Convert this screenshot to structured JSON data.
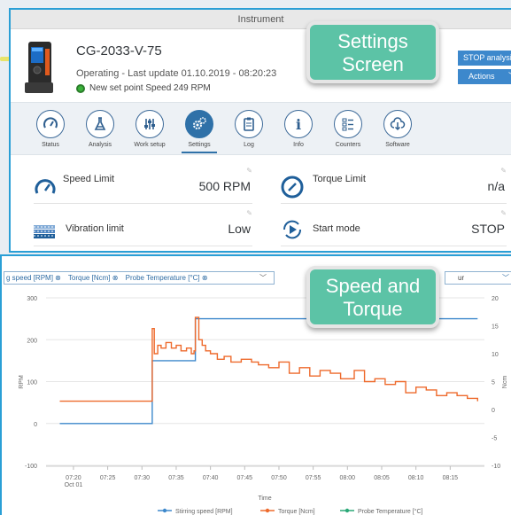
{
  "window": {
    "title": "Instrument"
  },
  "device": {
    "name": "CG-2033-V-75",
    "status": "Operating - Last update 01.10.2019 - 08:20:23",
    "setpoint": "New set point Speed 249 RPM"
  },
  "buttons": {
    "stop": "STOP analysis",
    "actions": "Actions"
  },
  "tabs": [
    {
      "label": "Status",
      "icon": "gauge-icon"
    },
    {
      "label": "Analysis",
      "icon": "flask-icon"
    },
    {
      "label": "Work setup",
      "icon": "sliders-icon"
    },
    {
      "label": "Settings",
      "icon": "gears-icon",
      "active": true
    },
    {
      "label": "Log",
      "icon": "clipboard-icon"
    },
    {
      "label": "Info",
      "icon": "info-icon"
    },
    {
      "label": "Counters",
      "icon": "list-icon"
    },
    {
      "label": "Software",
      "icon": "cloud-download-icon"
    }
  ],
  "settings": [
    {
      "name": "Speed Limit",
      "value": "500 RPM",
      "icon": "speedometer-icon"
    },
    {
      "name": "Torque Limit",
      "value": "n/a",
      "icon": "gauge-icon"
    },
    {
      "name": "Vibration limit",
      "value": "Low",
      "icon": "vibration-icon"
    },
    {
      "name": "Start mode",
      "value": "STOP",
      "icon": "play-cycle-icon"
    }
  ],
  "series_selector": {
    "items": [
      "g speed [RPM] ⊗",
      "Torque [Ncm] ⊗",
      "Probe Temperature [°C] ⊗"
    ]
  },
  "right_selector": {
    "value": "ur"
  },
  "callouts": {
    "settings": [
      "Settings",
      "Screen"
    ],
    "speed": [
      "Speed and",
      "Torque"
    ]
  },
  "colors": {
    "speed": "#3d88cc",
    "torque": "#ee6a2c",
    "temperature": "#2aa877",
    "accent": "#2a9fd6",
    "callout": "#5cc3a6"
  },
  "chart_data": {
    "type": "line",
    "xlabel": "Time",
    "ylabel_left": "RPM",
    "ylabel_right": "Ncm",
    "ylim_left": [
      -100,
      300
    ],
    "ylim_right": [
      -10,
      20
    ],
    "yticks_left": [
      "300",
      "200",
      "100",
      "0",
      "-100"
    ],
    "yticks_right": [
      "20",
      "15",
      "10",
      "5",
      "0",
      "-5",
      "-10"
    ],
    "xticks": [
      "07:20",
      "07:25",
      "07:30",
      "07:35",
      "07:40",
      "07:45",
      "07:50",
      "07:55",
      "08:00",
      "08:05",
      "08:10",
      "08:15"
    ],
    "xtick_sub": "Oct 01",
    "legend": [
      "Stirring speed [RPM]",
      "Torque [Ncm]",
      "Probe Temperature [°C]"
    ],
    "series": [
      {
        "name": "Stirring speed [RPM]",
        "axis": "left",
        "x": [
          18,
          31.5,
          31.5,
          37.8,
          37.8,
          40,
          45,
          50,
          55,
          60,
          65,
          70,
          75,
          79
        ],
        "values": [
          0,
          0,
          150,
          150,
          250,
          250,
          250,
          250,
          250,
          250,
          250,
          250,
          250,
          250
        ]
      },
      {
        "name": "Torque [Ncm]",
        "axis": "right",
        "x": [
          18,
          31.5,
          31.5,
          31.8,
          32.3,
          32.8,
          33.5,
          34.3,
          35,
          35.7,
          36.5,
          37.2,
          37.6,
          37.8,
          38.3,
          38.8,
          39.3,
          40,
          41,
          42,
          43,
          44.5,
          46,
          47,
          48.5,
          50,
          51.5,
          53,
          54.5,
          56,
          57.5,
          59,
          61,
          62.5,
          64,
          65.5,
          67,
          68.5,
          70,
          71.5,
          73,
          74.5,
          76,
          77.5,
          79
        ],
        "values": [
          1.5,
          1.5,
          14.5,
          10,
          11.5,
          11,
          12,
          11,
          11.5,
          10.5,
          11,
          10,
          10.5,
          16.5,
          12.5,
          11.5,
          10.5,
          10,
          9,
          9.5,
          8.5,
          9,
          8.5,
          8,
          7.5,
          8.5,
          6.5,
          7.5,
          6,
          7,
          6.5,
          5.5,
          7,
          5,
          5.5,
          4.5,
          5,
          3,
          4,
          3.5,
          2.5,
          3,
          2.5,
          2,
          1.5
        ]
      }
    ]
  }
}
